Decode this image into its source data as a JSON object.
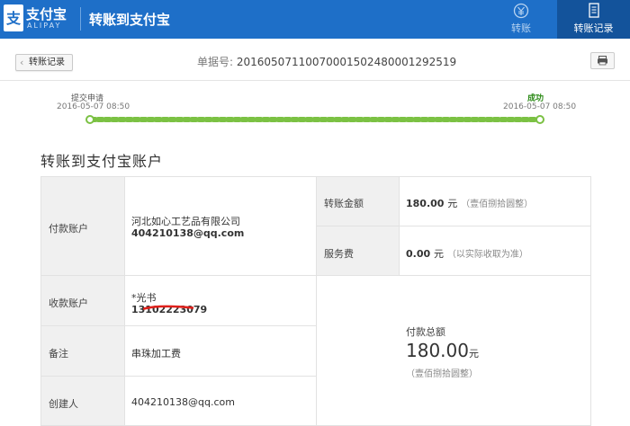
{
  "header": {
    "brand": "支付宝",
    "brand_sub": "ALIPAY",
    "title": "转账到支付宝",
    "nav": [
      {
        "label": "转账",
        "icon": "yuan-circle-icon",
        "active": false
      },
      {
        "label": "转账记录",
        "icon": "document-icon",
        "active": true
      }
    ]
  },
  "topbar": {
    "back_label": "转账记录",
    "order_label": "单据号:",
    "order_no": "20160507110070001502480001292519"
  },
  "progress": {
    "start_label": "提交申请",
    "start_date": "2016-05-07 08:50",
    "end_label": "成功",
    "end_date": "2016-05-07 08:50",
    "color": "#7bc143"
  },
  "section_title": "转账到支付宝账户",
  "details": {
    "payer_label": "付款账户",
    "payer_name": "河北如心工艺品有限公司",
    "payer_account": "404210138@qq.com",
    "amount_label": "转账金额",
    "amount_value": "180.00",
    "amount_unit": "元",
    "amount_words": "（壹佰捌拾圆整）",
    "fee_label": "服务费",
    "fee_value": "0.00",
    "fee_unit": "元",
    "fee_note": "（以实际收取为准）",
    "payee_label": "收款账户",
    "payee_name": "*光书",
    "payee_account": "13102223079",
    "memo_label": "备注",
    "memo_value": "串珠加工费",
    "creator_label": "创建人",
    "creator_value": "404210138@qq.com",
    "total_label": "付款总额",
    "total_value": "180.00",
    "total_unit": "元",
    "total_words": "（壹佰捌拾圆整）"
  }
}
